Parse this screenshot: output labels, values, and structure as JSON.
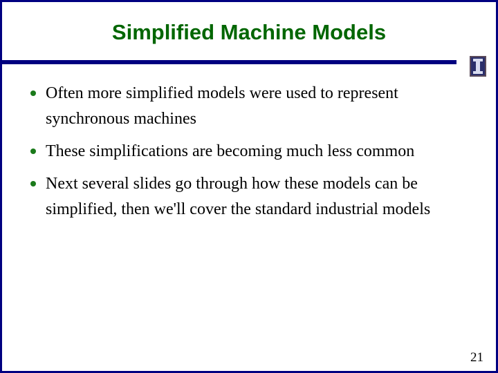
{
  "slide": {
    "title": "Simplified Machine Models",
    "logo_icon": "university-of-illinois-block-i-icon",
    "bullets": [
      {
        "text": "Often more simplified models were used to represent synchronous machines"
      },
      {
        "text": "These simplifications are becoming much less common"
      },
      {
        "text": "Next several slides go through how these models can be simplified, then we'll cover the standard industrial models"
      }
    ],
    "page_number": "21"
  },
  "colors": {
    "title": "#006600",
    "border": "#000080",
    "bar": "#000080",
    "bullet": "#1a7a1a"
  }
}
